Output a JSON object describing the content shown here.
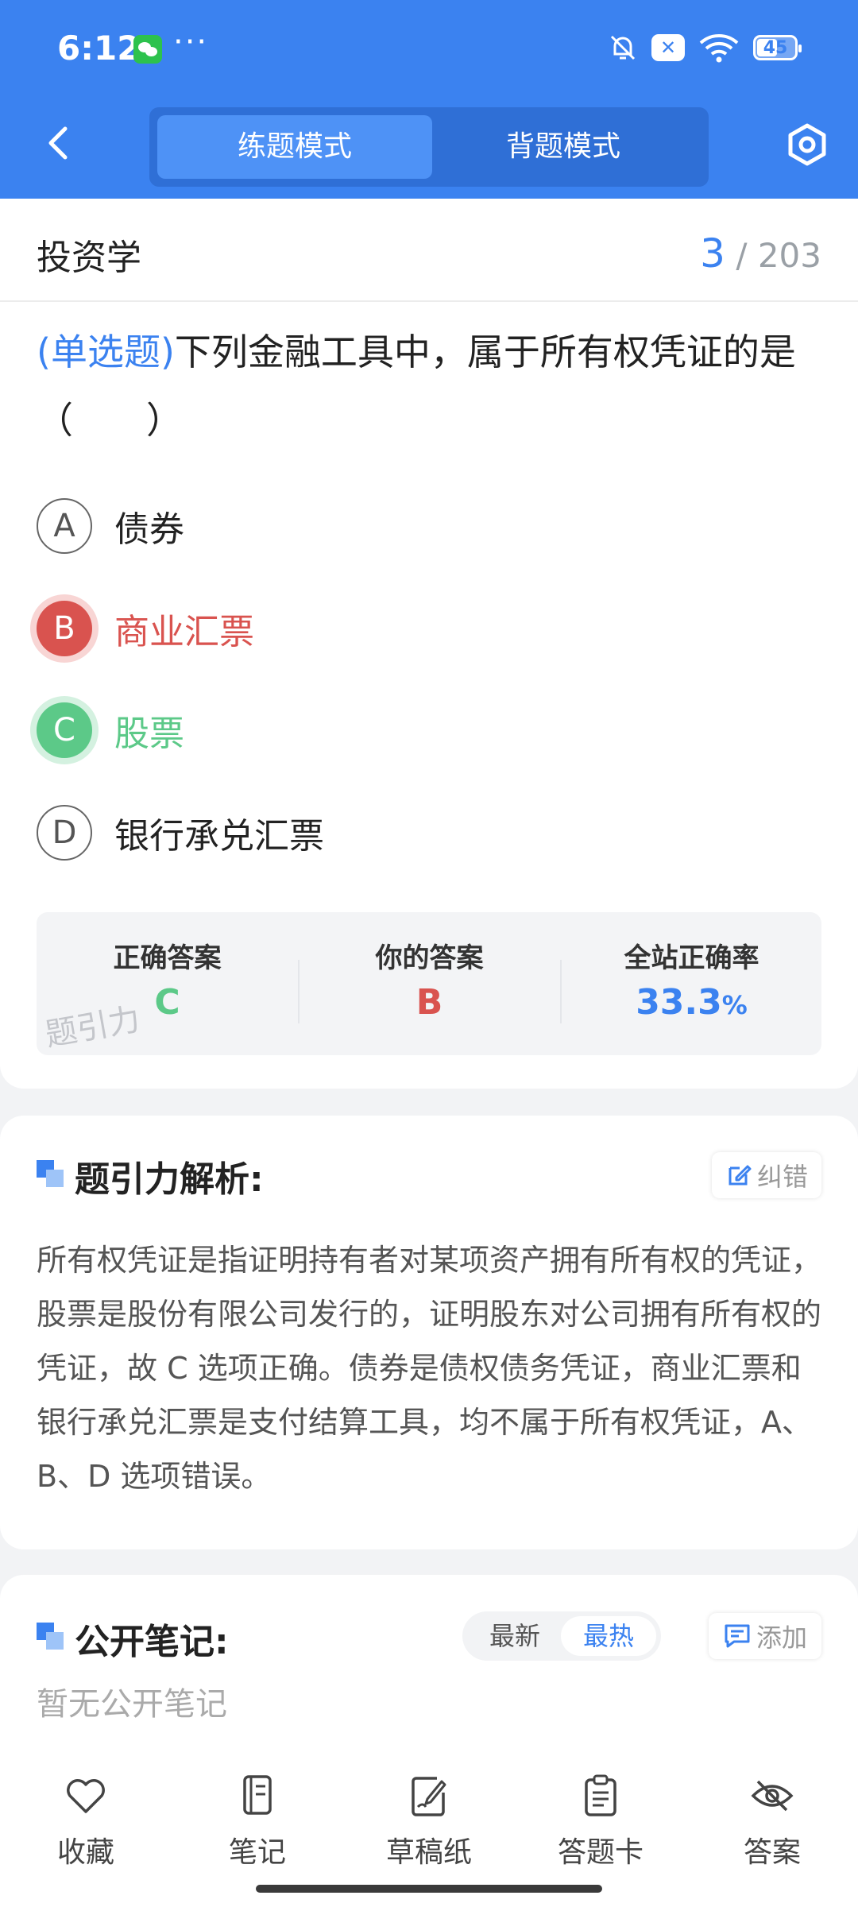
{
  "status_bar": {
    "time": "6:12",
    "dots": "···",
    "battery": "45"
  },
  "header": {
    "mode_practice": "练题模式",
    "mode_memorize": "背题模式"
  },
  "question_card": {
    "subject": "投资学",
    "current": "3",
    "total": "/ 203",
    "question_type": "(单选题)",
    "question_text": "下列金融工具中，属于所有权凭证的是（　　）",
    "options": [
      {
        "letter": "A",
        "text": "债券"
      },
      {
        "letter": "B",
        "text": "商业汇票"
      },
      {
        "letter": "C",
        "text": "股票"
      },
      {
        "letter": "D",
        "text": "银行承兑汇票"
      }
    ],
    "answer_summary": {
      "correct_label": "正确答案",
      "correct_value": "C",
      "yours_label": "你的答案",
      "yours_value": "B",
      "rate_label": "全站正确率",
      "rate_value": "33.3",
      "rate_unit": "%",
      "watermark": "题引力"
    }
  },
  "analysis": {
    "title": "题引力解析:",
    "fix_label": "纠错",
    "body": "所有权凭证是指证明持有者对某项资产拥有所有权的凭证，股票是股份有限公司发行的，证明股东对公司拥有所有权的凭证，故 C 选项正确。债券是债权债务凭证，商业汇票和银行承兑汇票是支付结算工具，均不属于所有权凭证，A、B、D 选项错误。"
  },
  "notes": {
    "title": "公开笔记:",
    "sort_latest": "最新",
    "sort_hottest": "最热",
    "add_label": "添加",
    "empty": "暂无公开笔记"
  },
  "bottom_nav": {
    "favorite": "收藏",
    "notes": "笔记",
    "scratch": "草稿纸",
    "answer_card": "答题卡",
    "answer": "答案"
  },
  "colors": {
    "primary": "#3b82f0",
    "wrong": "#d9534f",
    "correct": "#5cc988"
  }
}
